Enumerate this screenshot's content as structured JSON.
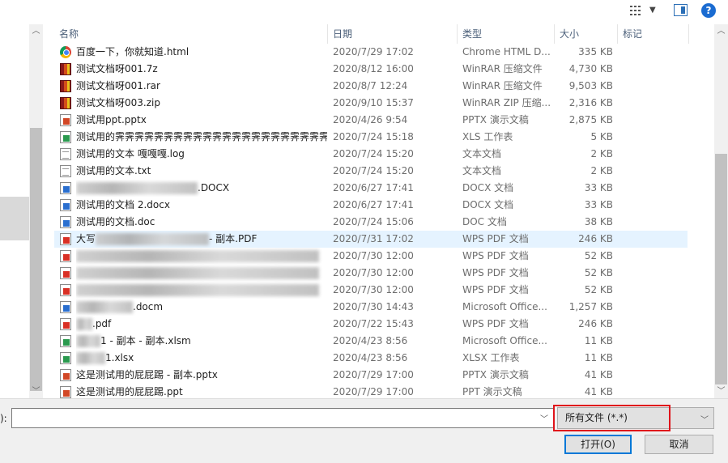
{
  "columns": {
    "name": "名称",
    "date": "日期",
    "type": "类型",
    "size": "大小",
    "tag": "标记"
  },
  "files": [
    {
      "name": "百度一下，你就知道.html",
      "date": "2020/7/29 17:02",
      "type": "Chrome HTML D...",
      "size": "335 KB",
      "icon": "chrome-html-icon"
    },
    {
      "name": "测试文档呀001.7z",
      "date": "2020/8/12 16:00",
      "type": "WinRAR 压缩文件",
      "size": "4,730 KB",
      "icon": "winrar-archive-icon"
    },
    {
      "name": "测试文档呀001.rar",
      "date": "2020/8/7 12:24",
      "type": "WinRAR 压缩文件",
      "size": "9,503 KB",
      "icon": "winrar-archive-icon"
    },
    {
      "name": "测试文档呀003.zip",
      "date": "2020/9/10 15:37",
      "type": "WinRAR ZIP 压缩...",
      "size": "2,316 KB",
      "icon": "winrar-archive-icon"
    },
    {
      "name": "测试用ppt.pptx",
      "date": "2020/4/26 9:54",
      "type": "PPTX 演示文稿",
      "size": "2,875 KB",
      "icon": "pptx-file-icon"
    },
    {
      "name": "测试用的霁霁霁霁霁霁霁霁霁霁霁霁霁霁霁霁霁霁霁霁霁霁...",
      "date": "2020/7/24 15:18",
      "type": "XLS 工作表",
      "size": "5 KB",
      "icon": "xls-file-icon"
    },
    {
      "name": "测试用的文本 嘎嘎嘎.log",
      "date": "2020/7/24 15:20",
      "type": "文本文档",
      "size": "2 KB",
      "icon": "text-file-icon"
    },
    {
      "name": "测试用的文本.txt",
      "date": "2020/7/24 15:20",
      "type": "文本文档",
      "size": "2 KB",
      "icon": "text-file-icon"
    },
    {
      "name": ".DOCX",
      "date": "2020/6/27 17:41",
      "type": "DOCX 文档",
      "size": "33 KB",
      "icon": "docx-file-icon"
    },
    {
      "name": "测试用的文档 2.docx",
      "date": "2020/6/27 17:41",
      "type": "DOCX 文档",
      "size": "33 KB",
      "icon": "docx-file-icon"
    },
    {
      "name": "测试用的文档.doc",
      "date": "2020/7/24 15:06",
      "type": "DOC 文档",
      "size": "38 KB",
      "icon": "doc-file-icon"
    },
    {
      "name": "大写",
      "name_suffix": "- 副本.PDF",
      "date": "2020/7/31 17:02",
      "type": "WPS PDF 文档",
      "size": "246 KB",
      "icon": "pdf-file-icon"
    },
    {
      "name": "",
      "date": "2020/7/30 12:00",
      "type": "WPS PDF 文档",
      "size": "52 KB",
      "icon": "pdf-file-icon"
    },
    {
      "name": "",
      "date": "2020/7/30 12:00",
      "type": "WPS PDF 文档",
      "size": "52 KB",
      "icon": "pdf-file-icon"
    },
    {
      "name": "",
      "date": "2020/7/30 12:00",
      "type": "WPS PDF 文档",
      "size": "52 KB",
      "icon": "pdf-file-icon"
    },
    {
      "name": ".docm",
      "date": "2020/7/30 14:43",
      "type": "Microsoft Office...",
      "size": "1,257 KB",
      "icon": "docm-file-icon"
    },
    {
      "name": "",
      "name_suffix": ".pdf",
      "date": "2020/7/22 15:43",
      "type": "WPS PDF 文档",
      "size": "246 KB",
      "icon": "pdf-file-icon"
    },
    {
      "name": "1 - 副本 - 副本.xlsm",
      "date": "2020/4/23 8:56",
      "type": "Microsoft Office...",
      "size": "11 KB",
      "icon": "xlsm-file-icon"
    },
    {
      "name": "1.xlsx",
      "date": "2020/4/23 8:56",
      "type": "XLSX 工作表",
      "size": "11 KB",
      "icon": "xlsx-file-icon"
    },
    {
      "name": "这是测试用的屁屁踢 - 副本.pptx",
      "date": "2020/7/29 17:00",
      "type": "PPTX 演示文稿",
      "size": "41 KB",
      "icon": "pptx-file-icon"
    },
    {
      "name": "这是测试用的屁屁踢.ppt",
      "date": "2020/7/29 17:00",
      "type": "PPT 演示文稿",
      "size": "41 KB",
      "icon": "ppt-file-icon"
    }
  ],
  "selected_row": 11,
  "filename": {
    "label": "):",
    "value": ""
  },
  "filter": {
    "value": "所有文件 (*.*)"
  },
  "buttons": {
    "open": "打开(O)",
    "cancel": "取消"
  },
  "icons": {
    "help": "?"
  },
  "colors": {
    "accent": "#0078d7",
    "highlight": "#e0141b",
    "selection": "#e5f3ff"
  }
}
